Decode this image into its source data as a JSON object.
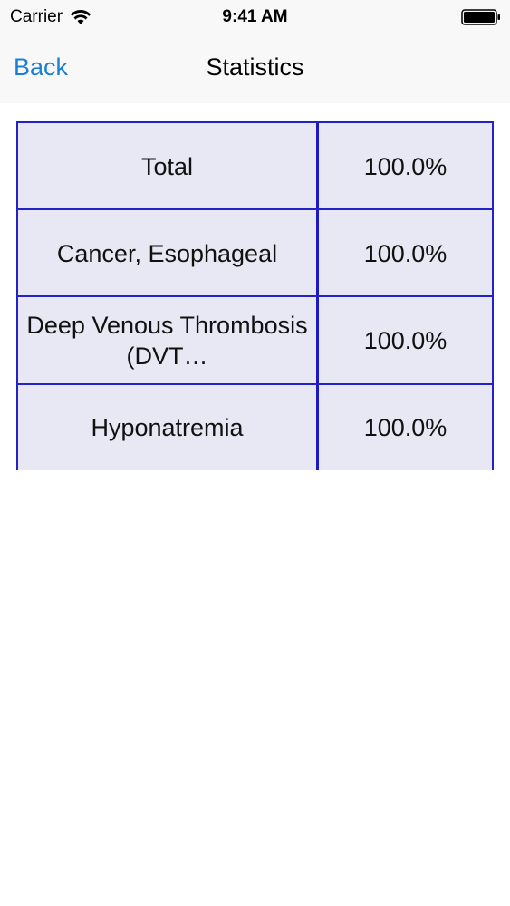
{
  "status_bar": {
    "carrier": "Carrier",
    "time": "9:41 AM",
    "icons": [
      "wifi-icon",
      "battery-icon"
    ]
  },
  "nav": {
    "back_label": "Back",
    "title": "Statistics",
    "back_color": "#1a7fd4"
  },
  "table": {
    "border_color": "#2222c8",
    "rows": [
      {
        "label": "Total",
        "value": "100.0%"
      },
      {
        "label": "Cancer, Esophageal",
        "value": "100.0%"
      },
      {
        "label": "Deep Venous Thrombosis (DVT…",
        "value": "100.0%"
      },
      {
        "label": "Hyponatremia",
        "value": "100.0%"
      }
    ]
  }
}
